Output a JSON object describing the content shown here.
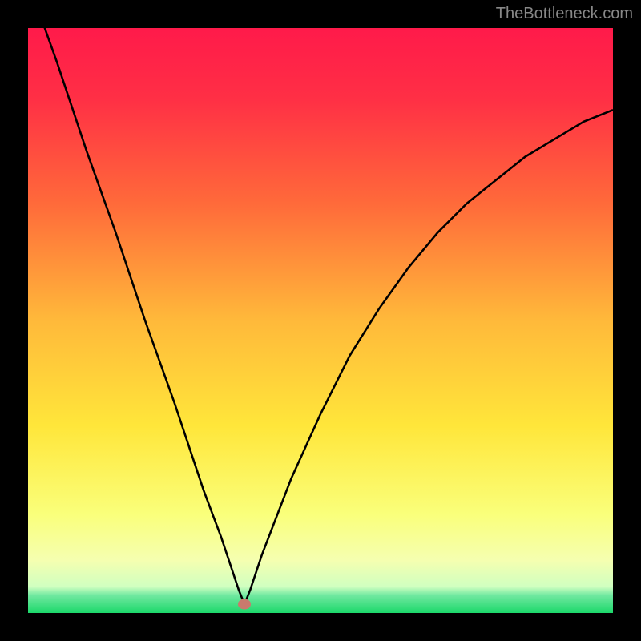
{
  "watermark": "TheBottleneck.com",
  "colors": {
    "frame": "#000000",
    "gradient_top": "#ff1a4a",
    "gradient_mid1": "#ff6a3a",
    "gradient_mid2": "#ffb93a",
    "gradient_mid3": "#ffe63a",
    "gradient_mid4": "#faff7a",
    "gradient_band": "#f0ffb0",
    "gradient_bottom": "#1cd86a",
    "curve": "#000000",
    "marker": "#c97a6d"
  },
  "chart_data": {
    "type": "line",
    "title": "",
    "xlabel": "",
    "ylabel": "",
    "xlim": [
      0,
      100
    ],
    "ylim": [
      0,
      100
    ],
    "minimum_x": 37,
    "marker": {
      "x": 37,
      "y": 1.5
    },
    "series": [
      {
        "name": "bottleneck-curve",
        "x": [
          0,
          5,
          10,
          15,
          20,
          25,
          30,
          33,
          35,
          36,
          37,
          38,
          40,
          45,
          50,
          55,
          60,
          65,
          70,
          75,
          80,
          85,
          90,
          95,
          100
        ],
        "y": [
          108,
          94,
          79,
          65,
          50,
          36,
          21,
          13,
          7,
          4,
          1.5,
          4,
          10,
          23,
          34,
          44,
          52,
          59,
          65,
          70,
          74,
          78,
          81,
          84,
          86
        ]
      }
    ]
  }
}
